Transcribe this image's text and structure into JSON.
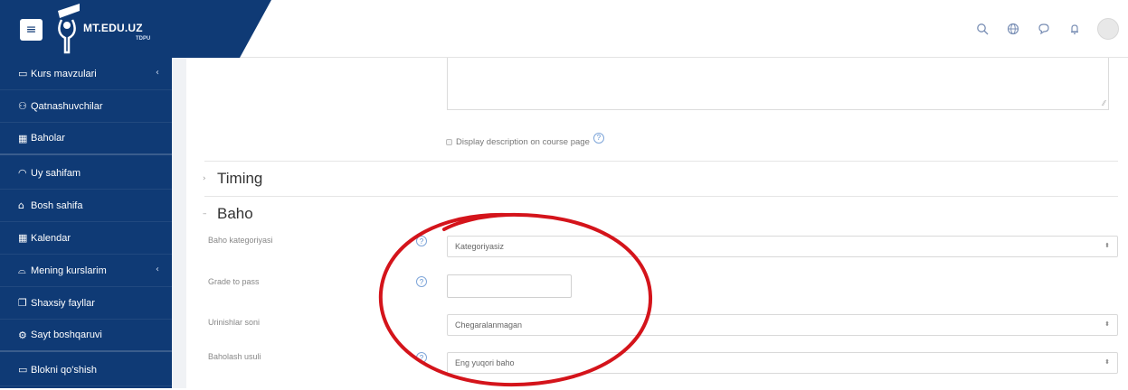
{
  "header": {
    "logo_text": "MT.EDU.UZ",
    "logo_sub": "TDPU",
    "icons": [
      "search-icon",
      "globe-icon",
      "chat-icon",
      "bell-icon",
      "avatar"
    ]
  },
  "sidebar": {
    "items": [
      {
        "label": "Kurs mavzulari",
        "icon": "folder-icon",
        "chevron": "‹"
      },
      {
        "label": "Qatnashuvchilar",
        "icon": "users-icon",
        "chevron": ""
      },
      {
        "label": "Baholar",
        "icon": "grades-icon",
        "chevron": ""
      },
      {
        "label": "Uy sahifam",
        "icon": "dashboard-icon",
        "chevron": ""
      },
      {
        "label": "Bosh sahifa",
        "icon": "home-icon",
        "chevron": ""
      },
      {
        "label": "Kalendar",
        "icon": "calendar-icon",
        "chevron": ""
      },
      {
        "label": "Mening kurslarim",
        "icon": "graduation-icon",
        "chevron": "‹"
      },
      {
        "label": "Shaxsiy fayllar",
        "icon": "files-icon",
        "chevron": ""
      },
      {
        "label": "Sayt boshqaruvi",
        "icon": "gear-icon",
        "chevron": ""
      },
      {
        "label": "Blokni qo'shish",
        "icon": "add-block-icon",
        "chevron": ""
      }
    ]
  },
  "form": {
    "display_description_label": "Display description on course page",
    "sections": {
      "timing": "Timing",
      "baho": "Baho"
    },
    "fields": {
      "grade_category": {
        "label": "Baho kategoriyasi",
        "value": "Kategoriyasiz"
      },
      "grade_to_pass": {
        "label": "Grade to pass",
        "value": ""
      },
      "attempts": {
        "label": "Urinishlar soni",
        "value": "Chegaralanmagan"
      },
      "grading_method": {
        "label": "Baholash usuli",
        "value": "Eng yuqori baho"
      }
    }
  },
  "colors": {
    "sidebar_bg": "#0f3a75",
    "annotation_red": "#d4141b"
  }
}
